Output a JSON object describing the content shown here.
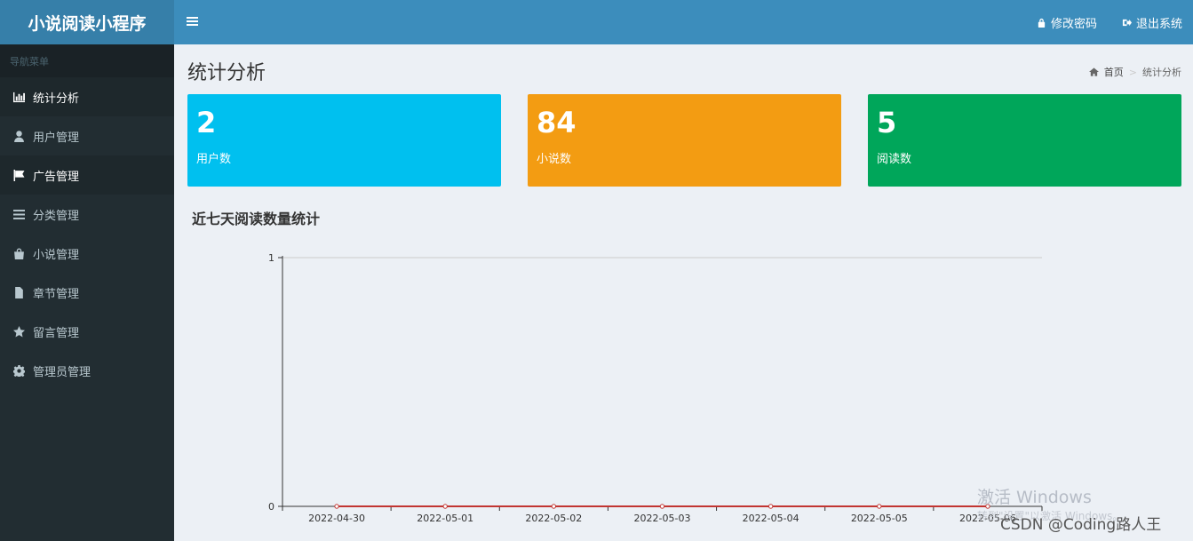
{
  "app": {
    "title": "小说阅读小程序"
  },
  "header": {
    "change_password": "修改密码",
    "logout": "退出系统"
  },
  "sidebar": {
    "header": "导航菜单",
    "items": [
      {
        "label": "统计分析",
        "icon": "bar-chart-icon"
      },
      {
        "label": "用户管理",
        "icon": "user-icon"
      },
      {
        "label": "广告管理",
        "icon": "flag-icon"
      },
      {
        "label": "分类管理",
        "icon": "list-icon"
      },
      {
        "label": "小说管理",
        "icon": "shopping-bag-icon"
      },
      {
        "label": "章节管理",
        "icon": "file-icon"
      },
      {
        "label": "留言管理",
        "icon": "star-icon"
      },
      {
        "label": "管理员管理",
        "icon": "gear-icon"
      }
    ]
  },
  "page": {
    "title": "统计分析",
    "breadcrumb": {
      "home": "首页",
      "current": "统计分析"
    }
  },
  "stats": [
    {
      "value": "2",
      "label": "用户数",
      "color": "#00c0ef"
    },
    {
      "value": "84",
      "label": "小说数",
      "color": "#f39c12"
    },
    {
      "value": "5",
      "label": "阅读数",
      "color": "#00a65a"
    }
  ],
  "chart": {
    "title": "近七天阅读数量统计"
  },
  "chart_data": {
    "type": "line",
    "categories": [
      "2022-04-30",
      "2022-05-01",
      "2022-05-02",
      "2022-05-03",
      "2022-05-04",
      "2022-05-05",
      "2022-05-06"
    ],
    "values": [
      0,
      0,
      0,
      0,
      0,
      0,
      0
    ],
    "ylim": [
      0,
      1
    ],
    "yticks": [
      0,
      1
    ],
    "line_color": "#c23531",
    "grid": true
  },
  "watermark": {
    "line1": "激活 Windows",
    "line2": "转到\"设置\"以激活 Windows。",
    "csdn": "CSDN @Coding路人王"
  }
}
